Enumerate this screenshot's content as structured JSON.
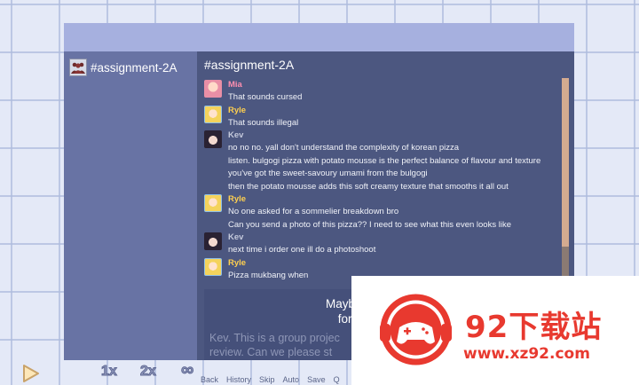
{
  "channel": {
    "sidebar_name": "#assignment-2A",
    "title": "#assignment-2A"
  },
  "messages": [
    {
      "sender": "Mia",
      "color": "#ff8fb0",
      "lines": [
        "That sounds cursed"
      ]
    },
    {
      "sender": "Ryle",
      "color": "#ffd04f",
      "lines": [
        "That sounds illegal"
      ]
    },
    {
      "sender": "Kev",
      "color": "#c4c9db",
      "lines": [
        "no no no. yall don't understand the complexity of korean pizza",
        "listen. bulgogi pizza with potato mousse is the perfect balance of flavour and texture",
        "you've got the sweet-savoury umami from the bulgogi",
        "then the potato mousse adds this soft creamy texture that smooths it all out"
      ]
    },
    {
      "sender": "Ryle",
      "color": "#ffd04f",
      "lines": [
        "No one asked for a sommelier breakdown bro",
        "Can you send a photo of this pizza?? I need to see what this even looks like"
      ]
    },
    {
      "sender": "Kev",
      "color": "#c4c9db",
      "lines": [
        "next time i order one ill do a photoshoot"
      ]
    },
    {
      "sender": "Ryle",
      "color": "#ffd04f",
      "lines": [
        "Pizza mukbang when"
      ]
    }
  ],
  "choices": {
    "option_1_line_1": "Maybe let's save the pizza",
    "option_1_line_2": "for after the slides are",
    "option_2_line_1": "Kev. This is a group projec",
    "option_2_line_2": "review. Can we please st"
  },
  "controls": {
    "speed_1x": "1x",
    "speed_2x": "2x",
    "speed_inf": "∞",
    "quick_menu": [
      "Back",
      "History",
      "Skip",
      "Auto",
      "Save",
      "Q"
    ]
  },
  "watermark": {
    "title": "92下载站",
    "url": "www.xz92.com"
  }
}
